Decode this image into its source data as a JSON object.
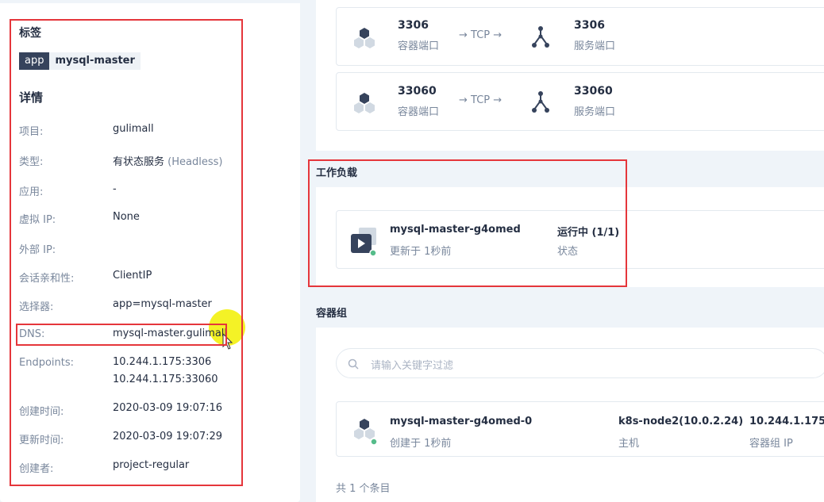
{
  "labels_section": {
    "title": "标签",
    "tag_key": "app",
    "tag_value": "mysql-master"
  },
  "details_section": {
    "title": "详情",
    "rows": [
      {
        "label": "项目:",
        "value": "gulimall"
      },
      {
        "label": "类型:",
        "value": "有状态服务",
        "value_muted": "(Headless)"
      },
      {
        "label": "应用:",
        "value": "-"
      },
      {
        "label": "虚拟 IP:",
        "value": "None"
      },
      {
        "label": "外部 IP:",
        "value": ""
      },
      {
        "label": "会话亲和性:",
        "value": "ClientIP"
      },
      {
        "label": "选择器:",
        "value": "app=mysql-master"
      },
      {
        "label": "DNS:",
        "value": "mysql-master.gulimall"
      },
      {
        "label": "Endpoints:",
        "value": "10.244.1.175:3306",
        "value2": "10.244.1.175:33060"
      },
      {
        "label": "创建时间:",
        "value": "2020-03-09 19:07:16"
      },
      {
        "label": "更新时间:",
        "value": "2020-03-09 19:07:29"
      },
      {
        "label": "创建者:",
        "value": "project-regular"
      }
    ]
  },
  "ports": [
    {
      "container_port": "3306",
      "container_port_label": "容器端口",
      "protocol": "→ TCP →",
      "service_port": "3306",
      "service_port_label": "服务端口"
    },
    {
      "container_port": "33060",
      "container_port_label": "容器端口",
      "protocol": "→ TCP →",
      "service_port": "33060",
      "service_port_label": "服务端口"
    }
  ],
  "workloads": {
    "title": "工作负载",
    "item": {
      "name": "mysql-master-g4omed",
      "updated": "更新于 1秒前",
      "status": "运行中 (1/1)",
      "status_label": "状态"
    }
  },
  "pods": {
    "title": "容器组",
    "search_placeholder": "请输入关键字过滤",
    "item": {
      "name": "mysql-master-g4omed-0",
      "created": "创建于 1秒前",
      "node": "k8s-node2(10.0.2.24)",
      "node_label": "主机",
      "ip": "10.244.1.175",
      "ip_label": "容器组 IP"
    },
    "total": "共 1 个条目"
  },
  "colors": {
    "highlight_border": "#e5363b",
    "running_dot": "#55bc8a",
    "tag_key_bg": "#36435c"
  }
}
